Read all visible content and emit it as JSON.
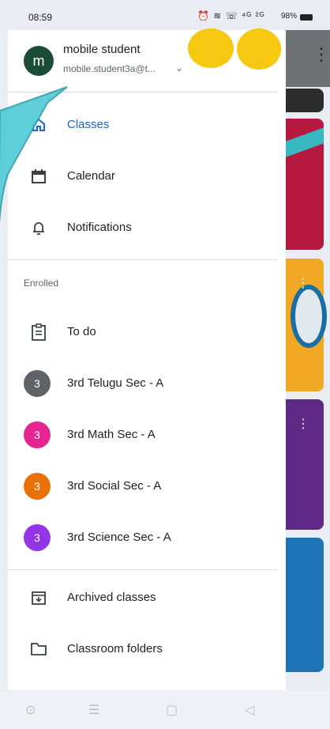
{
  "status_bar": {
    "time": "08:59",
    "icons_text": "⏰ ≋ ☏ ⁴ᴳ ²ᴳ",
    "battery": "98%"
  },
  "account": {
    "initial": "m",
    "name": "mobile student",
    "email": "mobile.student3a@t..."
  },
  "nav": {
    "classes": "Classes",
    "calendar": "Calendar",
    "notifications": "Notifications"
  },
  "enrolled": {
    "label": "Enrolled",
    "todo": "To do",
    "classes": [
      {
        "initial": "3",
        "name": "3rd Telugu Sec - A",
        "color": "#5f6368"
      },
      {
        "initial": "3",
        "name": "3rd Math Sec - A",
        "color": "#e52592"
      },
      {
        "initial": "3",
        "name": "3rd Social Sec - A",
        "color": "#e8710a"
      },
      {
        "initial": "3",
        "name": "3rd Science Sec - A",
        "color": "#9334e6"
      }
    ]
  },
  "footer_nav": {
    "archived": "Archived classes",
    "folders": "Classroom folders"
  },
  "colors": {
    "accent": "#1967d2",
    "annotation": "#4ecbd6",
    "scribble": "#f6c811"
  }
}
